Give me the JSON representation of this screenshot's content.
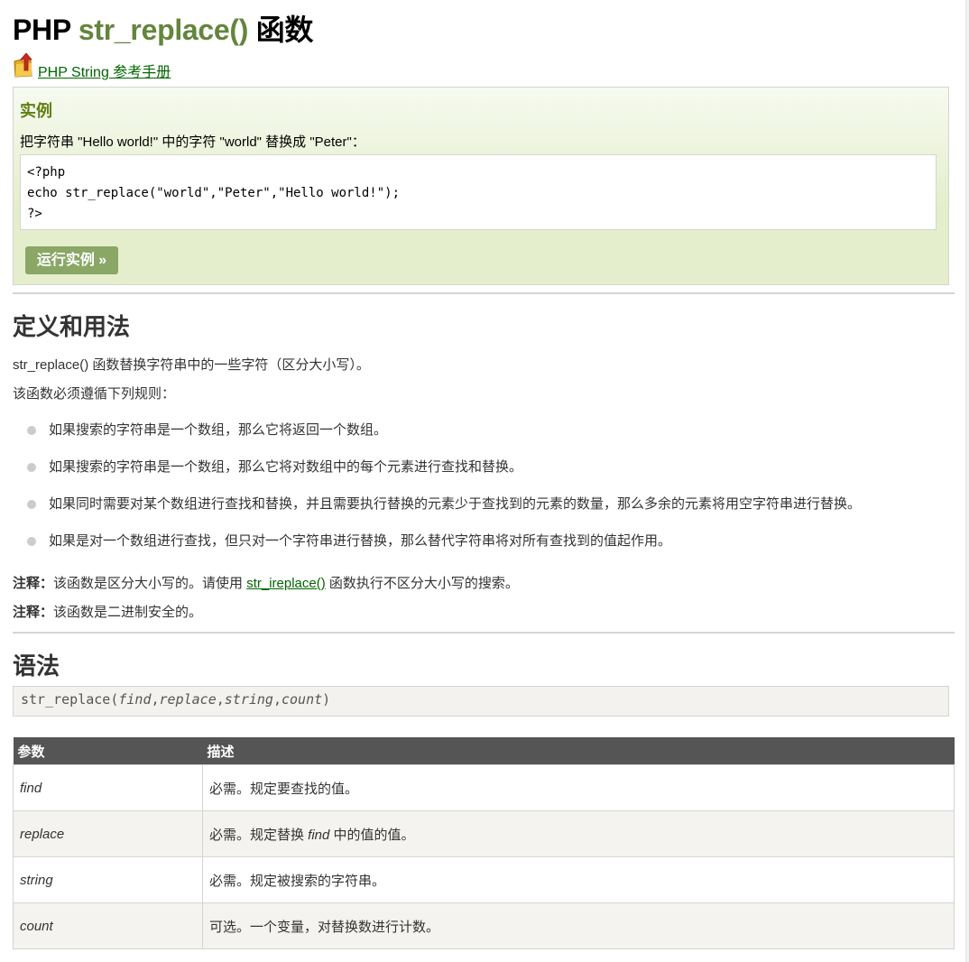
{
  "title": {
    "prefix": "PHP",
    "function_name": "str_replace()",
    "suffix": "函数"
  },
  "reference_link": "PHP String 参考手册",
  "example": {
    "heading": "实例",
    "description": "把字符串 \"Hello world!\" 中的字符 \"world\" 替换成 \"Peter\"：",
    "code": "<?php\necho str_replace(\"world\",\"Peter\",\"Hello world!\");\n?>",
    "run_button": "运行实例 »"
  },
  "definition": {
    "heading": "定义和用法",
    "intro": "str_replace() 函数替换字符串中的一些字符（区分大小写）。",
    "rules_intro": "该函数必须遵循下列规则：",
    "rules": [
      "如果搜索的字符串是一个数组，那么它将返回一个数组。",
      "如果搜索的字符串是一个数组，那么它将对数组中的每个元素进行查找和替换。",
      "如果同时需要对某个数组进行查找和替换，并且需要执行替换的元素少于查找到的元素的数量，那么多余的元素将用空字符串进行替换。",
      "如果是对一个数组进行查找，但只对一个字符串进行替换，那么替代字符串将对所有查找到的值起作用。"
    ],
    "note1": {
      "label": "注释：",
      "text_before": "该函数是区分大小写的。请使用 ",
      "link": "str_ireplace()",
      "text_after": " 函数执行不区分大小写的搜索。"
    },
    "note2": {
      "label": "注释：",
      "text": "该函数是二进制安全的。"
    }
  },
  "syntax": {
    "heading": "语法",
    "fn": "str_replace(",
    "args": [
      "find",
      "replace",
      "string",
      "count"
    ],
    "sep": ",",
    "close": ")"
  },
  "params_table": {
    "headers": [
      "参数",
      "描述"
    ],
    "rows": [
      {
        "param": "find",
        "desc": "必需。规定要查找的值。"
      },
      {
        "param": "replace",
        "desc_before": "必需。规定替换 ",
        "desc_em": "find",
        "desc_after": " 中的值的值。"
      },
      {
        "param": "string",
        "desc": "必需。规定被搜索的字符串。"
      },
      {
        "param": "count",
        "desc": "可选。一个变量，对替换数进行计数。"
      }
    ]
  },
  "icons": {
    "reference": "folder-arrow-icon"
  },
  "colors": {
    "accent": "#64853d",
    "link": "#006600",
    "example_bg": "#e5eecc",
    "button": "#8aa766",
    "table_header": "#555555"
  }
}
